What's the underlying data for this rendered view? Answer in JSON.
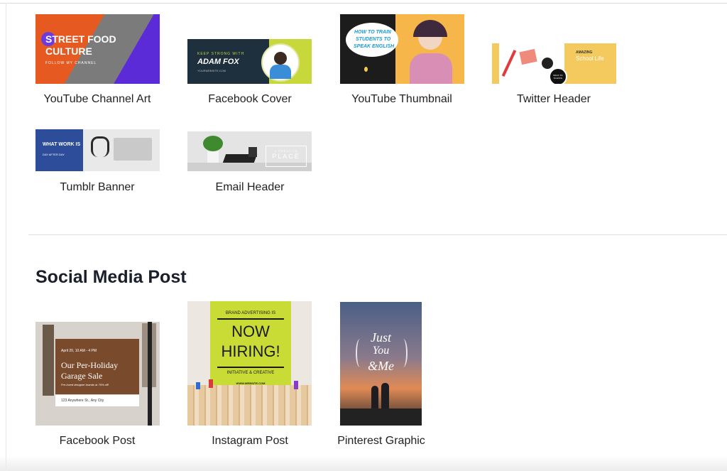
{
  "templates_top": [
    {
      "label": "YouTube Channel Art",
      "thumb": {
        "line1": "STREET FOOD",
        "line2": "CULTURE",
        "sub": "FOLLOW MY CHANNEL"
      }
    },
    {
      "label": "Facebook Cover",
      "thumb": {
        "line1": "KEEP STRONG WITH",
        "line2": "ADAM FOX",
        "sub": "YOURWEBSITE.COM"
      }
    },
    {
      "label": "YouTube Thumbnail",
      "thumb": {
        "line1": "HOW TO TRAIN",
        "line2": "STUDENTS TO",
        "line3": "SPEAK ENGLISH"
      }
    },
    {
      "label": "Twitter Header",
      "thumb": {
        "line1": "AMAZING",
        "line2": "School Life",
        "badge": "BACK TO SCHOOL"
      }
    },
    {
      "label": "Tumblr Banner",
      "thumb": {
        "line1": "WHAT WORK IS",
        "line2": "DAY AFTER DAY"
      }
    },
    {
      "label": "Email Header",
      "thumb": {
        "line1": "A CREATIVE",
        "line2": "PLACE"
      }
    }
  ],
  "social_section": {
    "title": "Social Media Post",
    "templates": [
      {
        "label": "Facebook Post",
        "thumb": {
          "date": "April 20, 10 AM - 4 PM",
          "title1": "Our Per-Holiday",
          "title2": "Garage Sale",
          "sub": "Pre-loved designer brands at 70% off!",
          "address": "123 Anywhere St., Any City"
        }
      },
      {
        "label": "Instagram Post",
        "thumb": {
          "top": "BRAND ADVERTISING IS",
          "main1": "NOW",
          "main2": "HIRING!",
          "sub": "INITIATIVE & CREATIVE",
          "site": "WWW.WEBSITE.COM"
        }
      },
      {
        "label": "Pinterest Graphic",
        "thumb": {
          "line1": "Just",
          "line2": "You",
          "line3": "&Me"
        }
      }
    ]
  },
  "colors": {
    "accent_orange": "#e65a22",
    "accent_purple": "#5a2bd6",
    "lime": "#c8dc35",
    "gold": "#f4c95d"
  }
}
